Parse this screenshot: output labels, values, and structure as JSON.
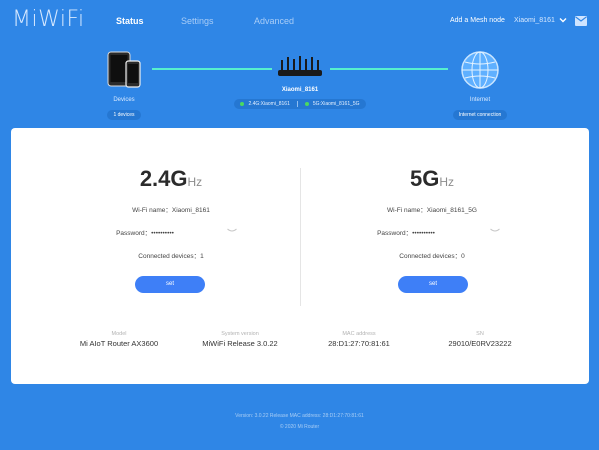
{
  "header": {
    "logo": "MiWiFi",
    "tabs": [
      {
        "label": "Status"
      },
      {
        "label": "Settings"
      },
      {
        "label": "Advanced"
      }
    ],
    "mesh_link": "Add a Mesh node",
    "router_select": "Xiaomi_8161"
  },
  "topology": {
    "devices": {
      "label": "Devices",
      "count": "1 devices"
    },
    "router": {
      "name": "Xiaomi_8161",
      "ssid_24": "2.4G:Xiaomi_8161",
      "ssid_5": "5G:Xiaomi_8161_5G"
    },
    "internet": {
      "label": "Internet",
      "status": "Internet connection"
    }
  },
  "bands": [
    {
      "title": "2.4G",
      "unit": "Hz",
      "wifi_name_label": "Wi-Fi name：",
      "wifi_name": "Xiaomi_8161",
      "password_label": "Password：",
      "password_mask": "••••••••••",
      "connected_label": "Connected devices：",
      "connected_count": "1",
      "set_label": "set"
    },
    {
      "title": "5G",
      "unit": "Hz",
      "wifi_name_label": "Wi-Fi name：",
      "wifi_name": "Xiaomi_8161_5G",
      "password_label": "Password：",
      "password_mask": "••••••••••",
      "connected_label": "Connected devices：",
      "connected_count": "0",
      "set_label": "set"
    }
  ],
  "info": [
    {
      "label": "Model",
      "value": "Mi AIoT Router AX3600"
    },
    {
      "label": "System version",
      "value": "MiWiFi Release 3.0.22"
    },
    {
      "label": "MAC address",
      "value": "28:D1:27:70:81:61"
    },
    {
      "label": "SN",
      "value": "29010/E0RV23222"
    }
  ],
  "footer": {
    "line1": "Version: 3.0.22 Release  MAC address: 28:D1:27:70:81:61",
    "line2": "© 2020 Mi Router"
  },
  "colors": {
    "background": "#2f86e6",
    "link_line": "#56f0ce",
    "button": "#3e7ff7",
    "status_dot": "#4bd960"
  },
  "icons": {
    "mail": "mail-icon",
    "chevron": "chevron-down-icon",
    "devices": "devices-icon",
    "router": "router-icon",
    "internet": "globe-icon",
    "eye": "eye-closed-icon"
  }
}
